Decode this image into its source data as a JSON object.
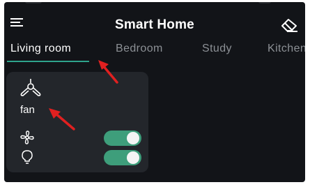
{
  "header": {
    "title": "Smart Home",
    "menu_icon": "menu-icon",
    "action_icon": "eraser-icon"
  },
  "tabs": [
    {
      "label": "Living room",
      "active": true
    },
    {
      "label": "Bedroom",
      "active": false
    },
    {
      "label": "Study",
      "active": false
    },
    {
      "label": "Kitchen",
      "active": false
    }
  ],
  "device_card": {
    "icon": "ceiling-fan-icon",
    "name": "fan",
    "controls": [
      {
        "icon": "fan-blade-icon",
        "on": true
      },
      {
        "icon": "light-bulb-icon",
        "on": true
      }
    ]
  },
  "annotations": {
    "color": "#e02020",
    "arrows": [
      "arrow-to-tab-living-room",
      "arrow-to-device-name-fan"
    ]
  },
  "colors": {
    "background": "#121418",
    "card": "#23262b",
    "accent": "#2fa48c",
    "toggle_on": "#3e9e7b",
    "tab_inactive": "#8c9095",
    "text": "#ffffff"
  }
}
